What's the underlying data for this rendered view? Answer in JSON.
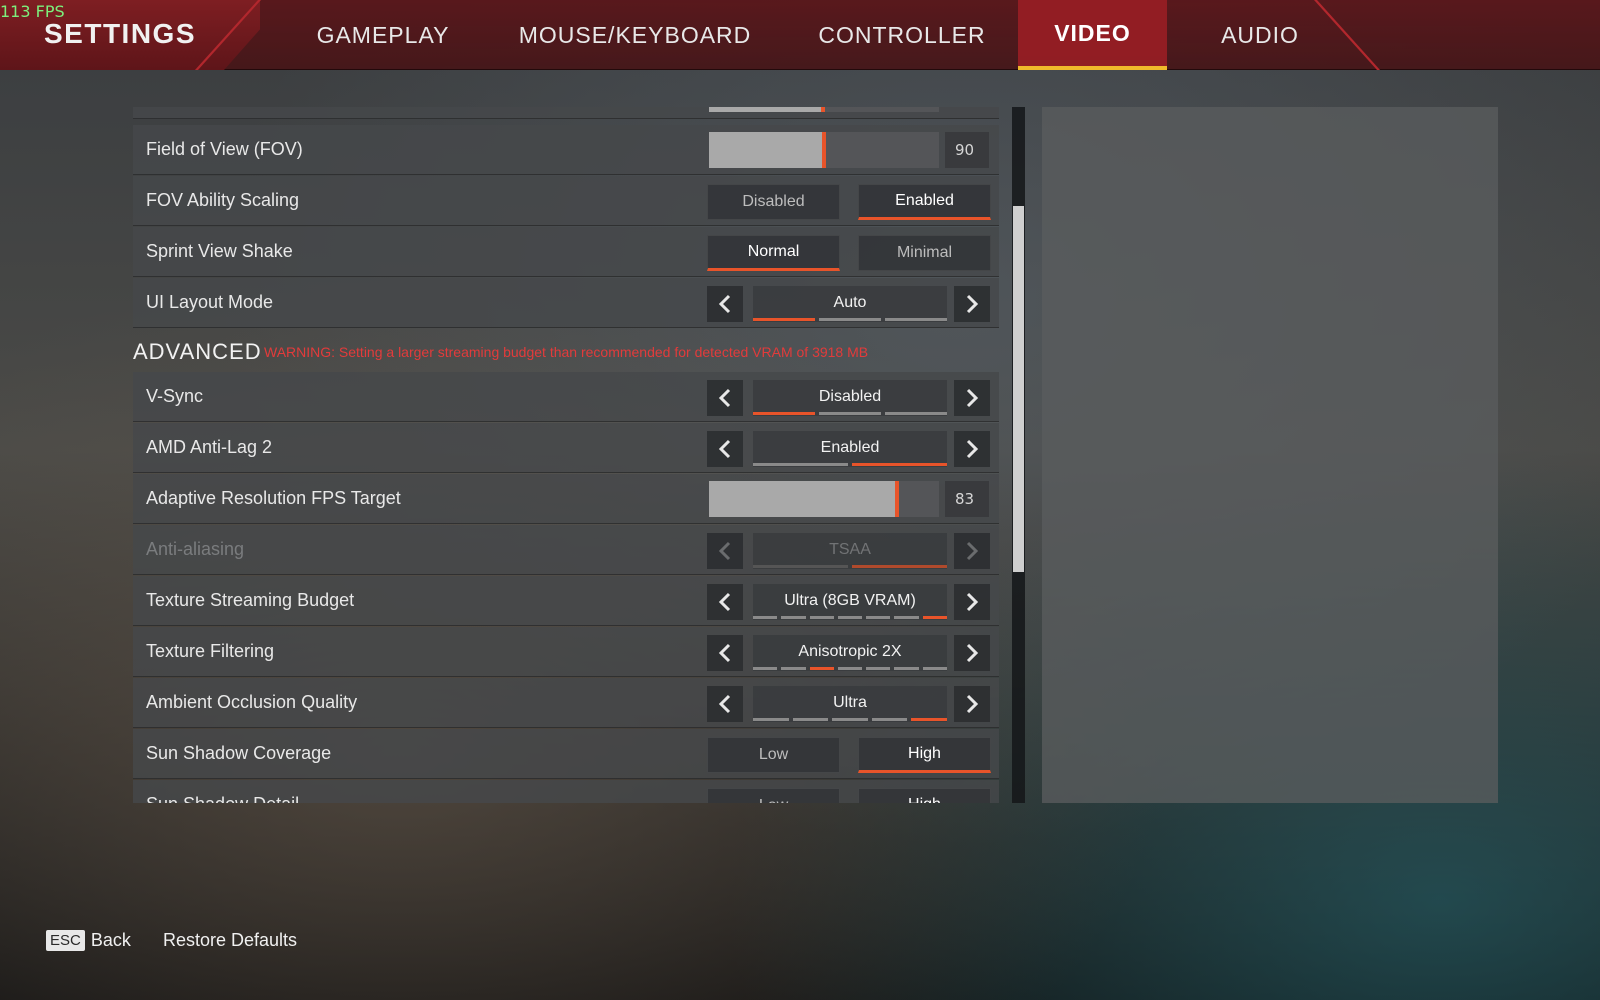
{
  "overlay": {
    "fps": "113 FPS"
  },
  "header": {
    "title": "SETTINGS",
    "tabs": [
      {
        "label": "GAMEPLAY",
        "active": false
      },
      {
        "label": "MOUSE/KEYBOARD",
        "active": false
      },
      {
        "label": "CONTROLLER",
        "active": false
      },
      {
        "label": "VIDEO",
        "active": true
      },
      {
        "label": "AUDIO",
        "active": false
      }
    ]
  },
  "settings": {
    "fov": {
      "label": "Field of View (FOV)",
      "value": "90",
      "fraction": 0.49
    },
    "fov_scaling": {
      "label": "FOV Ability Scaling",
      "options": [
        "Disabled",
        "Enabled"
      ],
      "selected": "Enabled"
    },
    "sprint_shake": {
      "label": "Sprint View Shake",
      "options": [
        "Normal",
        "Minimal"
      ],
      "selected": "Normal"
    },
    "ui_layout": {
      "label": "UI Layout Mode",
      "value": "Auto",
      "level": 1,
      "steps": 3
    },
    "advanced": {
      "heading": "ADVANCED",
      "warning": "WARNING: Setting a larger streaming budget than recommended for detected VRAM of 3918 MB"
    },
    "vsync": {
      "label": "V-Sync",
      "value": "Disabled",
      "level": 1,
      "steps": 3
    },
    "antilag": {
      "label": "AMD Anti-Lag 2",
      "value": "Enabled",
      "level": 2,
      "steps": 2
    },
    "adaptive_fps": {
      "label": "Adaptive Resolution FPS Target",
      "value": "83",
      "fraction": 0.81
    },
    "antialiasing": {
      "label": "Anti-aliasing",
      "value": "TSAA",
      "level": 2,
      "steps": 2,
      "disabled": true
    },
    "texture_budget": {
      "label": "Texture Streaming Budget",
      "value": "Ultra (8GB VRAM)",
      "level": 7,
      "steps": 7
    },
    "texture_filtering": {
      "label": "Texture Filtering",
      "value": "Anisotropic 2X",
      "level": 3,
      "steps": 7
    },
    "ambient_occlusion": {
      "label": "Ambient Occlusion Quality",
      "value": "Ultra",
      "level": 5,
      "steps": 5
    },
    "sun_shadow": {
      "label": "Sun Shadow Coverage",
      "options": [
        "Low",
        "High"
      ],
      "selected": "High"
    },
    "sun_shadow_detail": {
      "label": "Sun Shadow Detail",
      "options": [
        "Low",
        "High"
      ],
      "selected": "High"
    }
  },
  "footer": {
    "back_key": "ESC",
    "back_label": "Back",
    "restore_label": "Restore Defaults"
  },
  "colors": {
    "accent": "#e8542a",
    "tab_active_underline": "#f0b92b",
    "warning": "#e23b3b"
  }
}
